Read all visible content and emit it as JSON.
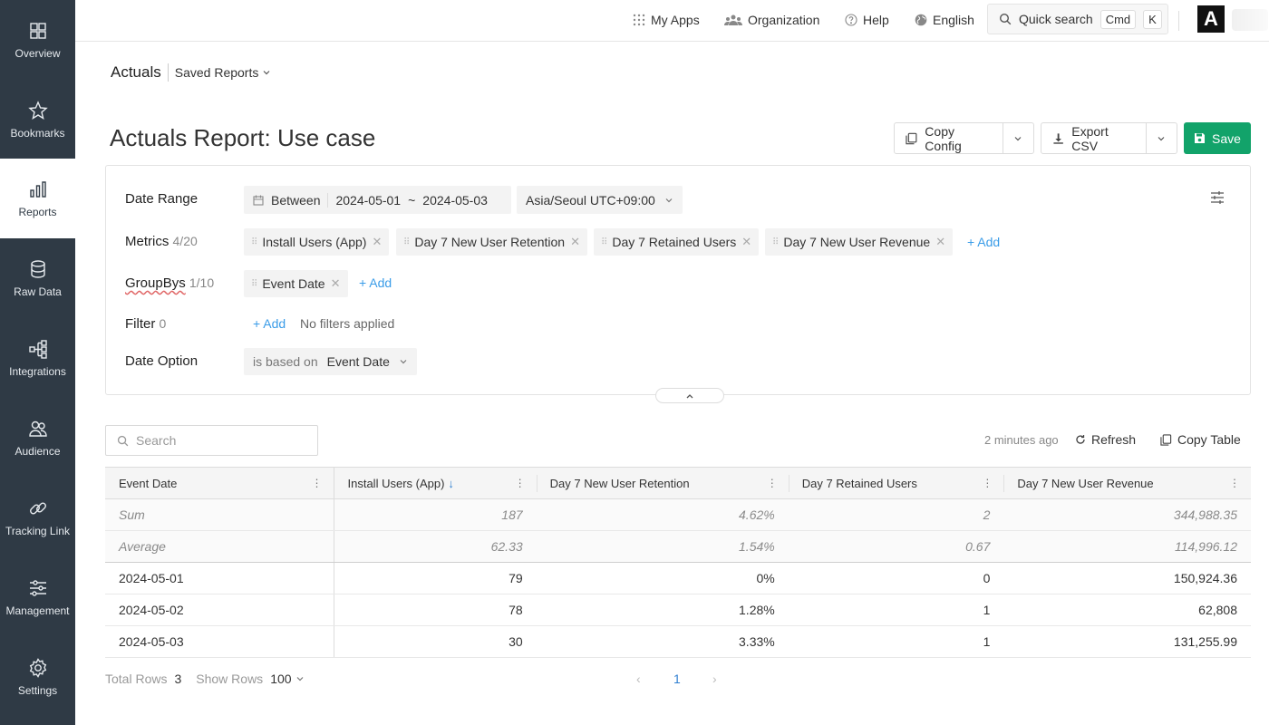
{
  "sidebar": {
    "items": [
      {
        "label": "Overview",
        "icon": "grid-icon"
      },
      {
        "label": "Bookmarks",
        "icon": "star-icon"
      },
      {
        "label": "Reports",
        "icon": "bar-chart-icon",
        "active": true
      },
      {
        "label": "Raw Data",
        "icon": "database-icon"
      },
      {
        "label": "Integrations",
        "icon": "tree-icon"
      },
      {
        "label": "Audience",
        "icon": "users-icon"
      },
      {
        "label": "Tracking Link",
        "icon": "link-icon"
      },
      {
        "label": "Management",
        "icon": "sliders-icon"
      },
      {
        "label": "Settings",
        "icon": "gear-icon"
      }
    ]
  },
  "topbar": {
    "my_apps": "My Apps",
    "organization": "Organization",
    "help": "Help",
    "language": "English",
    "quick_search": "Quick search",
    "kbd_cmd": "Cmd",
    "kbd_k": "K",
    "logo_letter": "A"
  },
  "breadcrumb": {
    "current": "Actuals",
    "saved_reports": "Saved Reports"
  },
  "page": {
    "title": "Actuals Report: Use case"
  },
  "header_actions": {
    "copy_config": "Copy Config",
    "export_csv": "Export CSV",
    "save": "Save"
  },
  "config": {
    "date_range": {
      "label": "Date Range",
      "mode": "Between",
      "start": "2024-05-01",
      "separator": "~",
      "end": "2024-05-03",
      "timezone": "Asia/Seoul UTC+09:00"
    },
    "metrics": {
      "label": "Metrics",
      "count": "4/20",
      "items": [
        "Install Users (App)",
        "Day 7 New User Retention",
        "Day 7 Retained Users",
        "Day 7 New User Revenue"
      ],
      "add": "+ Add"
    },
    "groupbys": {
      "label": "GroupBys",
      "count": "1/10",
      "items": [
        "Event Date"
      ],
      "add": "+ Add"
    },
    "filter": {
      "label": "Filter",
      "count": "0",
      "add": "+ Add",
      "empty_text": "No filters applied"
    },
    "date_option": {
      "label": "Date Option",
      "prefix": "is based on",
      "value": "Event Date"
    }
  },
  "toolbar": {
    "search_placeholder": "Search",
    "updated": "2 minutes ago",
    "refresh": "Refresh",
    "copy_table": "Copy Table"
  },
  "table": {
    "columns": [
      "Event Date",
      "Install Users (App)",
      "Day 7 New User Retention",
      "Day 7 Retained Users",
      "Day 7 New User Revenue"
    ],
    "sorted_column": 1,
    "sort_direction": "desc",
    "aggregates": [
      {
        "label": "Sum",
        "values": [
          "187",
          "4.62%",
          "2",
          "344,988.35"
        ]
      },
      {
        "label": "Average",
        "values": [
          "62.33",
          "1.54%",
          "0.67",
          "114,996.12"
        ]
      }
    ],
    "rows": [
      {
        "date": "2024-05-01",
        "values": [
          "79",
          "0%",
          "0",
          "150,924.36"
        ]
      },
      {
        "date": "2024-05-02",
        "values": [
          "78",
          "1.28%",
          "1",
          "62,808"
        ]
      },
      {
        "date": "2024-05-03",
        "values": [
          "30",
          "3.33%",
          "1",
          "131,255.99"
        ]
      }
    ]
  },
  "footer": {
    "total_rows_label": "Total Rows",
    "total_rows": "3",
    "show_rows_label": "Show Rows",
    "show_rows": "100",
    "current_page": "1"
  },
  "colors": {
    "sidebar_bg": "#2f3a45",
    "save_green": "#12a36a",
    "link_blue": "#3a9ce8"
  }
}
